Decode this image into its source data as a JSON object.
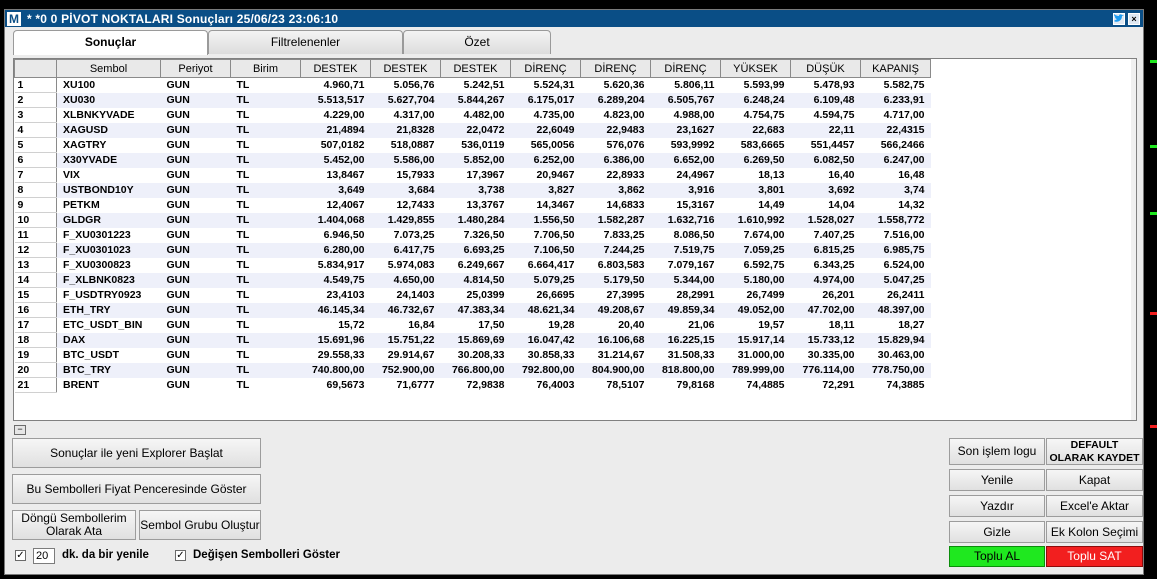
{
  "window": {
    "logo": "M",
    "title": "* *0  0 PİVOT NOKTALARI Sonuçları  25/06/23 23:06:10"
  },
  "tabs": [
    {
      "label": "Sonuçlar"
    },
    {
      "label": "Filtrelenenler"
    },
    {
      "label": "Özet"
    }
  ],
  "table": {
    "headers": [
      "",
      "Sembol",
      "Periyot",
      "Birim",
      "DESTEK",
      "DESTEK",
      "DESTEK",
      "DİRENÇ",
      "DİRENÇ",
      "DİRENÇ",
      "YÜKSEK",
      "DÜŞÜK",
      "KAPANIŞ"
    ],
    "rows": [
      [
        "1",
        "XU100",
        "GUN",
        "TL",
        "4.960,71",
        "5.056,76",
        "5.242,51",
        "5.524,31",
        "5.620,36",
        "5.806,11",
        "5.593,99",
        "5.478,93",
        "5.582,75"
      ],
      [
        "2",
        "XU030",
        "GUN",
        "TL",
        "5.513,517",
        "5.627,704",
        "5.844,267",
        "6.175,017",
        "6.289,204",
        "6.505,767",
        "6.248,24",
        "6.109,48",
        "6.233,91"
      ],
      [
        "3",
        "XLBNKYVADE",
        "GUN",
        "TL",
        "4.229,00",
        "4.317,00",
        "4.482,00",
        "4.735,00",
        "4.823,00",
        "4.988,00",
        "4.754,75",
        "4.594,75",
        "4.717,00"
      ],
      [
        "4",
        "XAGUSD",
        "GUN",
        "TL",
        "21,4894",
        "21,8328",
        "22,0472",
        "22,6049",
        "22,9483",
        "23,1627",
        "22,683",
        "22,11",
        "22,4315"
      ],
      [
        "5",
        "XAGTRY",
        "GUN",
        "TL",
        "507,0182",
        "518,0887",
        "536,0119",
        "565,0056",
        "576,076",
        "593,9992",
        "583,6665",
        "551,4457",
        "566,2466"
      ],
      [
        "6",
        "X30YVADE",
        "GUN",
        "TL",
        "5.452,00",
        "5.586,00",
        "5.852,00",
        "6.252,00",
        "6.386,00",
        "6.652,00",
        "6.269,50",
        "6.082,50",
        "6.247,00"
      ],
      [
        "7",
        "VIX",
        "GUN",
        "TL",
        "13,8467",
        "15,7933",
        "17,3967",
        "20,9467",
        "22,8933",
        "24,4967",
        "18,13",
        "16,40",
        "16,48"
      ],
      [
        "8",
        "USTBOND10Y",
        "GUN",
        "TL",
        "3,649",
        "3,684",
        "3,738",
        "3,827",
        "3,862",
        "3,916",
        "3,801",
        "3,692",
        "3,74"
      ],
      [
        "9",
        "PETKM",
        "GUN",
        "TL",
        "12,4067",
        "12,7433",
        "13,3767",
        "14,3467",
        "14,6833",
        "15,3167",
        "14,49",
        "14,04",
        "14,32"
      ],
      [
        "10",
        "GLDGR",
        "GUN",
        "TL",
        "1.404,068",
        "1.429,855",
        "1.480,284",
        "1.556,50",
        "1.582,287",
        "1.632,716",
        "1.610,992",
        "1.528,027",
        "1.558,772"
      ],
      [
        "11",
        "F_XU0301223",
        "GUN",
        "TL",
        "6.946,50",
        "7.073,25",
        "7.326,50",
        "7.706,50",
        "7.833,25",
        "8.086,50",
        "7.674,00",
        "7.407,25",
        "7.516,00"
      ],
      [
        "12",
        "F_XU0301023",
        "GUN",
        "TL",
        "6.280,00",
        "6.417,75",
        "6.693,25",
        "7.106,50",
        "7.244,25",
        "7.519,75",
        "7.059,25",
        "6.815,25",
        "6.985,75"
      ],
      [
        "13",
        "F_XU0300823",
        "GUN",
        "TL",
        "5.834,917",
        "5.974,083",
        "6.249,667",
        "6.664,417",
        "6.803,583",
        "7.079,167",
        "6.592,75",
        "6.343,25",
        "6.524,00"
      ],
      [
        "14",
        "F_XLBNK0823",
        "GUN",
        "TL",
        "4.549,75",
        "4.650,00",
        "4.814,50",
        "5.079,25",
        "5.179,50",
        "5.344,00",
        "5.180,00",
        "4.974,00",
        "5.047,25"
      ],
      [
        "15",
        "F_USDTRY0923",
        "GUN",
        "TL",
        "23,4103",
        "24,1403",
        "25,0399",
        "26,6695",
        "27,3995",
        "28,2991",
        "26,7499",
        "26,201",
        "26,2411"
      ],
      [
        "16",
        "ETH_TRY",
        "GUN",
        "TL",
        "46.145,34",
        "46.732,67",
        "47.383,34",
        "48.621,34",
        "49.208,67",
        "49.859,34",
        "49.052,00",
        "47.702,00",
        "48.397,00"
      ],
      [
        "17",
        "ETC_USDT_BIN",
        "GUN",
        "TL",
        "15,72",
        "16,84",
        "17,50",
        "19,28",
        "20,40",
        "21,06",
        "19,57",
        "18,11",
        "18,27"
      ],
      [
        "18",
        "DAX",
        "GUN",
        "TL",
        "15.691,96",
        "15.751,22",
        "15.869,69",
        "16.047,42",
        "16.106,68",
        "16.225,15",
        "15.917,14",
        "15.733,12",
        "15.829,94"
      ],
      [
        "19",
        "BTC_USDT",
        "GUN",
        "TL",
        "29.558,33",
        "29.914,67",
        "30.208,33",
        "30.858,33",
        "31.214,67",
        "31.508,33",
        "31.000,00",
        "30.335,00",
        "30.463,00"
      ],
      [
        "20",
        "BTC_TRY",
        "GUN",
        "TL",
        "740.800,00",
        "752.900,00",
        "766.800,00",
        "792.800,00",
        "804.900,00",
        "818.800,00",
        "789.999,00",
        "776.114,00",
        "778.750,00"
      ],
      [
        "21",
        "BRENT",
        "GUN",
        "TL",
        "69,5673",
        "71,6777",
        "72,9838",
        "76,4003",
        "78,5107",
        "79,8168",
        "74,4885",
        "72,291",
        "74,3885"
      ]
    ]
  },
  "buttons": {
    "new_explorer": "Sonuçlar ile yeni Explorer Başlat",
    "show_in_price": "Bu Sembolleri Fiyat Penceresinde Göster",
    "loop_symbols": "Döngü Sembollerim Olarak Ata",
    "symbol_group": "Sembol Grubu Oluştur",
    "last_log": "Son işlem logu",
    "default_save": "DEFAULT OLARAK KAYDET",
    "refresh": "Yenile",
    "close": "Kapat",
    "print": "Yazdır",
    "excel": "Excel'e Aktar",
    "hide": "Gizle",
    "extra_column": "Ek Kolon Seçimi",
    "bulk_buy": "Toplu AL",
    "bulk_sell": "Toplu SAT"
  },
  "options": {
    "refresh_minutes": "20",
    "refresh_label": "dk. da bir yenile",
    "show_changed_label": "Değişen Sembolleri Göster",
    "refresh_checked": "✓",
    "show_changed_checked": "✓"
  },
  "colors": {
    "title_bar": "#0a4e86",
    "row_alt": "#eef0fa",
    "buy": "#1fe81f",
    "sell": "#f21f1f"
  }
}
